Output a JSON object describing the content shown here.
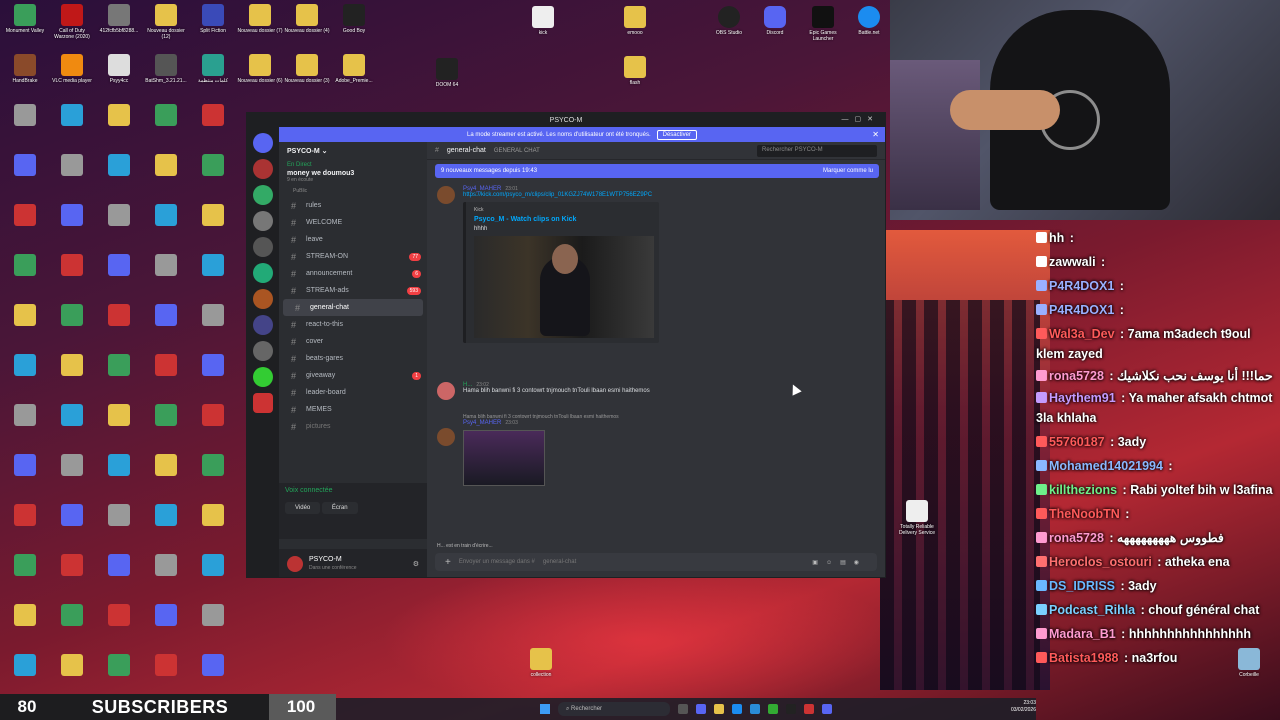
{
  "desktop": {
    "icons": [
      {
        "label": "Monument Valley",
        "color": "#3a9e5a"
      },
      {
        "label": "Call of Duty Warzone (2020)",
        "color": "#c01818"
      },
      {
        "label": "412fcfb5bf8288...",
        "color": "#777777"
      },
      {
        "label": "Nouveau dossier (12)",
        "color": "#e6c24a"
      },
      {
        "label": "Split Fiction",
        "color": "#3a4ab8"
      },
      {
        "label": "Nouveau dossier (7)",
        "color": "#e6c24a"
      },
      {
        "label": "Nouveau dossier (4)",
        "color": "#e6c24a"
      },
      {
        "label": "Good Boy",
        "color": "#222222"
      },
      {
        "label": "HandBrake",
        "color": "#8a4a2a"
      },
      {
        "label": "VLC media player",
        "color": "#f08a10"
      },
      {
        "label": "Psyy4cc",
        "color": "#dddddd"
      },
      {
        "label": "BatShm_3.21.21...",
        "color": "#555555"
      },
      {
        "label": "كلمات منتظمة",
        "color": "#2aa090"
      },
      {
        "label": "Nouveau dossier (6)",
        "color": "#e6c24a"
      },
      {
        "label": "Nouveau dossier (3)",
        "color": "#e6c24a"
      },
      {
        "label": "Adobe_Premie...",
        "color": "#e6c24a"
      }
    ],
    "extra_icons": [
      "kick",
      "emooo",
      "OBS Studio",
      "Discord",
      "Epic Games Launcher",
      "Battle.net",
      "DOOM 64",
      "flash",
      "Totally Reliable Delivery Service",
      "Corbeille",
      "collection"
    ]
  },
  "discord": {
    "window_title": "PSYCO-M",
    "streamer_banner": "La mode streamer est activé. Les noms d'utilisateur ont été tronqués.",
    "streamer_button": "Désactiver",
    "server_name": "PSYCO-M",
    "live_label": "En Direct",
    "live_title": "money we doumou3",
    "live_sub": "9 en écoute",
    "category": "PuBlic",
    "channels": [
      {
        "name": "rules",
        "badge": "",
        "muted": false
      },
      {
        "name": "WELCOME",
        "badge": "",
        "muted": false
      },
      {
        "name": "leave",
        "badge": "",
        "muted": false
      },
      {
        "name": "STREAM-ON",
        "badge": "77",
        "muted": false
      },
      {
        "name": "announcement",
        "badge": "6",
        "muted": false
      },
      {
        "name": "STREAM-ads",
        "badge": "593",
        "muted": false
      },
      {
        "name": "general-chat",
        "badge": "",
        "muted": false
      },
      {
        "name": "react-to-this",
        "badge": "",
        "muted": false
      },
      {
        "name": "cover",
        "badge": "",
        "muted": false
      },
      {
        "name": "beats-gares",
        "badge": "",
        "muted": false
      },
      {
        "name": "giveaway",
        "badge": "1",
        "muted": false
      },
      {
        "name": "leader-board",
        "badge": "",
        "muted": false
      },
      {
        "name": "MEMES",
        "badge": "",
        "muted": false
      },
      {
        "name": "pictures",
        "badge": "",
        "muted": true
      }
    ],
    "voice_connected": "Voix connectée",
    "voice_video": "Vidéo",
    "voice_screen": "Écran",
    "user_name": "PSYCO-M",
    "user_status": "Dans une conférence",
    "chat_channel": "general-chat",
    "chat_topic": "GENERAL CHAT",
    "search_placeholder": "Rechercher PSYCO-M",
    "new_messages": "9 nouveaux messages depuis 19:43",
    "mark_read": "Marquer comme lu",
    "msg1_user": "Psy4_MAHER",
    "msg1_time": "23:01",
    "msg1_link": "https://kick.com/psyco_m/clips/clip_01KGZJ74W178E1WTP756EZ9PC",
    "embed_provider": "Kick",
    "embed_title": "Psyco_M - Watch clips on Kick",
    "embed_desc": "hhhh",
    "msg2_user": "H...",
    "msg2_time": "23:02",
    "msg2_text": "Hama blih banwni fi 3 contowrt tnjmouch tnTouli lbaan esmi haithemos",
    "msg3_reply": "Hama blih banwni fi 3 contowrt tnjmouch tnTouli lbaan esmi haithemos",
    "msg3_user": "Psy4_MAHER",
    "msg3_time": "23:03",
    "typing": "H... est en train d'écrire...",
    "composer_placeholder": "Envoyer un message dans #",
    "composer_channel": "general-chat"
  },
  "stream_chat": [
    {
      "user": "hh",
      "text": "",
      "color": "#ffffff"
    },
    {
      "user": "zawwali",
      "text": "",
      "color": "#ffffff"
    },
    {
      "user": "P4R4DOX1",
      "text": "",
      "color": "#9ab0ff"
    },
    {
      "user": "P4R4DOX1",
      "text": "",
      "color": "#9ab0ff"
    },
    {
      "user": "Wal3a_Dev",
      "text": "7ama m3adech t9oul klem zayed",
      "color": "#ff5a5a"
    },
    {
      "user": "rona5728",
      "text": "حما!!! أنا يوسف نحب نكلاشيك",
      "color": "#ff9bd0"
    },
    {
      "user": "Haythem91",
      "text": "Ya maher afsakh chtmot 3la khlaha",
      "color": "#c49bff"
    },
    {
      "user": "55760187",
      "text": "3ady",
      "color": "#ff5a5a"
    },
    {
      "user": "Mohamed14021994",
      "text": "",
      "color": "#8ab8ff"
    },
    {
      "user": "killthezions",
      "text": "Rabi yoltef bih w l3afina",
      "color": "#6ef08a"
    },
    {
      "user": "TheNoobTN",
      "text": "",
      "color": "#ff5a5a"
    },
    {
      "user": "rona5728",
      "text": "فطووس هههههههههه",
      "color": "#ff9bd0"
    },
    {
      "user": "Heroclos_ostouri",
      "text": "atheka ena",
      "color": "#ff7070"
    },
    {
      "user": "DS_IDRISS",
      "text": "3ady",
      "color": "#6ab8ff"
    },
    {
      "user": "Podcast_Rihla",
      "text": "chouf général chat",
      "color": "#7ad0ff"
    },
    {
      "user": "Madara_B1",
      "text": "hhhhhhhhhhhhhhhh",
      "color": "#ff9bd0"
    },
    {
      "user": "Batista1988",
      "text": "na3rfou",
      "color": "#ff5a5a"
    }
  ],
  "subs": {
    "current": "80",
    "label": "SUBSCRIBERS",
    "goal": "100",
    "progress": 0.8
  },
  "taskbar": {
    "search_placeholder": "Rechercher",
    "time": "23:03",
    "date": "03/02/2026"
  }
}
